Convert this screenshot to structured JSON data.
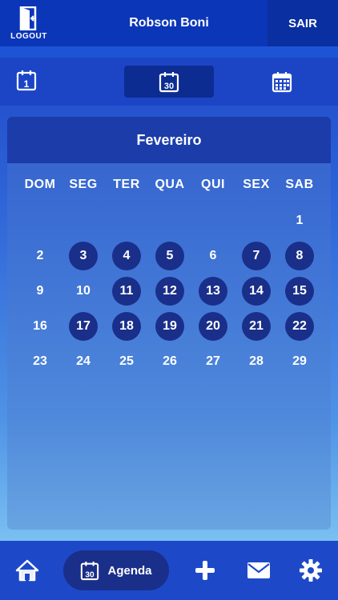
{
  "header": {
    "logout_label": "LOGOUT",
    "user_name": "Robson Boni",
    "exit_label": "SAIR"
  },
  "tabs": {
    "day_icon_number": "1",
    "month_icon_number": "30",
    "active": "month"
  },
  "calendar": {
    "month": "Fevereiro",
    "weekdays": [
      "DOM",
      "SEG",
      "TER",
      "QUA",
      "QUI",
      "SEX",
      "SAB"
    ],
    "first_weekday_index": 6,
    "days_in_month": 29,
    "marked_days": [
      3,
      4,
      5,
      7,
      8,
      11,
      12,
      13,
      14,
      15,
      17,
      18,
      19,
      20,
      21,
      22
    ]
  },
  "bottom_nav": {
    "agenda_label": "Agenda",
    "agenda_icon_number": "30"
  },
  "colors": {
    "header": "#0b36b8",
    "marked_day": "#1a2f8a",
    "active_tab": "#0c2c92"
  }
}
